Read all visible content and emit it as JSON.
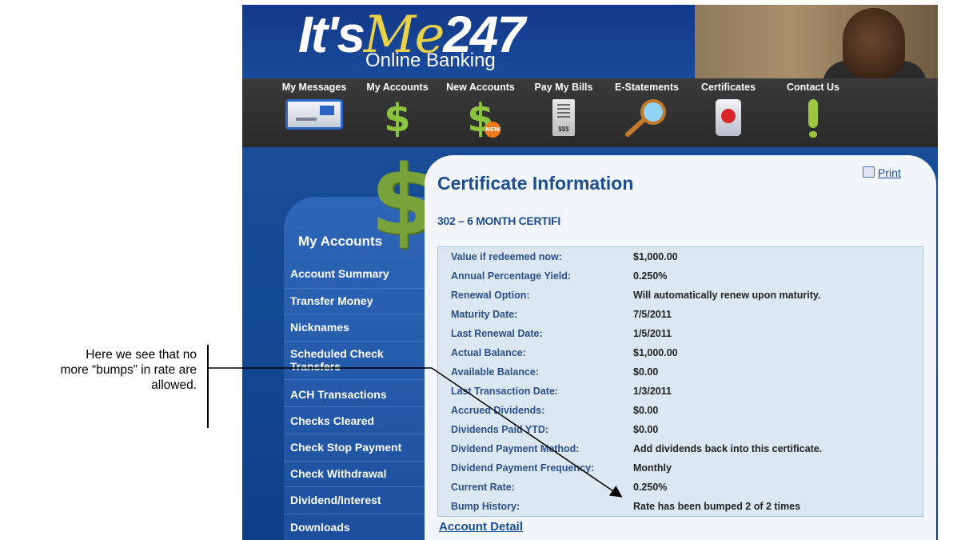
{
  "annotation": {
    "lines": [
      "Here we see that no",
      "more “bumps” in rate are",
      "allowed."
    ]
  },
  "header": {
    "logo_main": "It's",
    "logo_me": "Me",
    "logo_num": "247",
    "logo_sub": "Online Banking"
  },
  "nav": {
    "items": [
      {
        "label": "My Messages",
        "icon": "envelope-icon"
      },
      {
        "label": "My Accounts",
        "icon": "dollar-icon"
      },
      {
        "label": "New Accounts",
        "icon": "dollar-new-icon"
      },
      {
        "label": "Pay My Bills",
        "icon": "bill-icon",
        "icon_text": "$$$"
      },
      {
        "label": "E-Statements",
        "icon": "magnifier-icon"
      },
      {
        "label": "Certificates",
        "icon": "certificate-icon"
      },
      {
        "label": "Contact Us",
        "icon": "exclamation-icon"
      }
    ],
    "new_badge": "NEW"
  },
  "sidebar": {
    "title": "My Accounts",
    "items": [
      {
        "label": "Account Summary"
      },
      {
        "label": "Transfer Money"
      },
      {
        "label": "Nicknames"
      },
      {
        "label": "Scheduled Check Transfers"
      },
      {
        "label": "ACH Transactions"
      },
      {
        "label": "Checks Cleared"
      },
      {
        "label": "Check Stop Payment"
      },
      {
        "label": "Check Withdrawal"
      },
      {
        "label": "Dividend/Interest"
      },
      {
        "label": "Downloads"
      }
    ]
  },
  "content": {
    "title": "Certificate Information",
    "print_label": "Print",
    "account_name": "302 – 6 MONTH CERTIFI",
    "details": [
      {
        "label": "Value if redeemed now:",
        "value": "$1,000.00"
      },
      {
        "label": "Annual Percentage Yield:",
        "value": "0.250%"
      },
      {
        "label": "Renewal Option:",
        "value": "Will automatically renew upon maturity."
      },
      {
        "label": "Maturity Date:",
        "value": "7/5/2011"
      },
      {
        "label": "Last Renewal Date:",
        "value": "1/5/2011"
      },
      {
        "label": "Actual Balance:",
        "value": "$1,000.00"
      },
      {
        "label": "Available Balance:",
        "value": "$0.00"
      },
      {
        "label": "Last Transaction Date:",
        "value": "1/3/2011"
      },
      {
        "label": "Accrued Dividends:",
        "value": "$0.00"
      },
      {
        "label": "Dividends Paid YTD:",
        "value": "$0.00"
      },
      {
        "label": "Dividend Payment Method:",
        "value": "Add dividends back into this certificate."
      },
      {
        "label": "Dividend Payment Frequency:",
        "value": "Monthly"
      },
      {
        "label": "Current Rate:",
        "value": "0.250%"
      },
      {
        "label": "Bump History:",
        "value": "Rate has been bumped 2 of 2 times"
      }
    ],
    "account_detail_link": "Account Detail"
  }
}
